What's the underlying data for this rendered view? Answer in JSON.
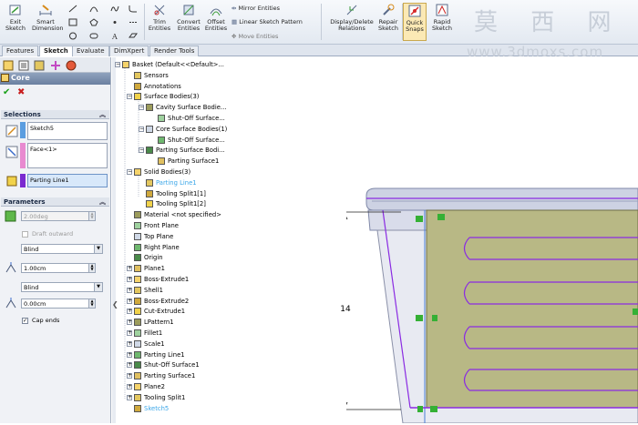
{
  "ribbon": {
    "exit_sketch": "Exit\nSketch",
    "smart_dimension": "Smart\nDimension",
    "trim_entities": "Trim\nEntities",
    "convert_entities": "Convert\nEntities",
    "offset_entities": "Offset\nEntities",
    "mirror_entities": "Mirror Entities",
    "linear_sketch_pattern": "Linear Sketch Pattern",
    "move_entities": "Move Entities",
    "display_delete_relations": "Display/Delete\nRelations",
    "repair_sketch": "Repair\nSketch",
    "quick_snaps": "Quick\nSnaps",
    "rapid_sketch": "Rapid\nSketch"
  },
  "tabs": [
    "Features",
    "Sketch",
    "Evaluate",
    "DimXpert",
    "Render Tools"
  ],
  "active_tab": "Sketch",
  "pm": {
    "title": "Core",
    "selections": {
      "header": "Selections",
      "sketch_value": "Sketch5",
      "face_value": "Face<1>",
      "parting_line_value": "Parting Line1"
    },
    "parameters": {
      "header": "Parameters",
      "draft_angle": "2.00deg",
      "draft_outward": "Draft outward",
      "end_condition_1": "Blind",
      "depth_1": "1.00cm",
      "end_condition_2": "Blind",
      "depth_2": "0.00cm",
      "cap_ends": "Cap ends"
    }
  },
  "tree": [
    {
      "label": "Basket  (Default<<Default>...",
      "indent": 0
    },
    {
      "label": "Sensors",
      "indent": 1
    },
    {
      "label": "Annotations",
      "indent": 1
    },
    {
      "label": "Surface Bodies(3)",
      "indent": 1
    },
    {
      "label": "Cavity Surface Bodie...",
      "indent": 2
    },
    {
      "label": "Shut-Off Surface...",
      "indent": 3
    },
    {
      "label": "Core Surface Bodies(1)",
      "indent": 2
    },
    {
      "label": "Shut-Off Surface...",
      "indent": 3
    },
    {
      "label": "Parting Surface Bodi...",
      "indent": 2
    },
    {
      "label": "Parting Surface1",
      "indent": 3
    },
    {
      "label": "Solid Bodies(3)",
      "indent": 1
    },
    {
      "label": "Parting Line1",
      "indent": 2,
      "selected": true
    },
    {
      "label": "Tooling Split1[1]",
      "indent": 2
    },
    {
      "label": "Tooling Split1[2]",
      "indent": 2
    },
    {
      "label": "Material <not specified>",
      "indent": 1
    },
    {
      "label": "Front Plane",
      "indent": 1
    },
    {
      "label": "Top Plane",
      "indent": 1
    },
    {
      "label": "Right Plane",
      "indent": 1
    },
    {
      "label": "Origin",
      "indent": 1
    },
    {
      "label": "Plane1",
      "indent": 1
    },
    {
      "label": "Boss-Extrude1",
      "indent": 1
    },
    {
      "label": "Shell1",
      "indent": 1
    },
    {
      "label": "Boss-Extrude2",
      "indent": 1
    },
    {
      "label": "Cut-Extrude1",
      "indent": 1
    },
    {
      "label": "LPattern1",
      "indent": 1
    },
    {
      "label": "Fillet1",
      "indent": 1
    },
    {
      "label": "Scale1",
      "indent": 1
    },
    {
      "label": "Parting Line1",
      "indent": 1
    },
    {
      "label": "Shut-Off Surface1",
      "indent": 1
    },
    {
      "label": "Parting Surface1",
      "indent": 1
    },
    {
      "label": "Plane2",
      "indent": 1
    },
    {
      "label": "Tooling Split1",
      "indent": 1
    },
    {
      "label": "Sketch5",
      "indent": 1,
      "selected": true
    }
  ],
  "viewport": {
    "dimension": "14",
    "watermark": "莫 西 网",
    "watermark_url": "www.3dmoxs.com"
  },
  "colors": {
    "accent_blue": "#3aa6e8",
    "model_fill": "#b8b885",
    "sketch_purple": "#8a2be2",
    "check_green": "#1aa11a"
  }
}
